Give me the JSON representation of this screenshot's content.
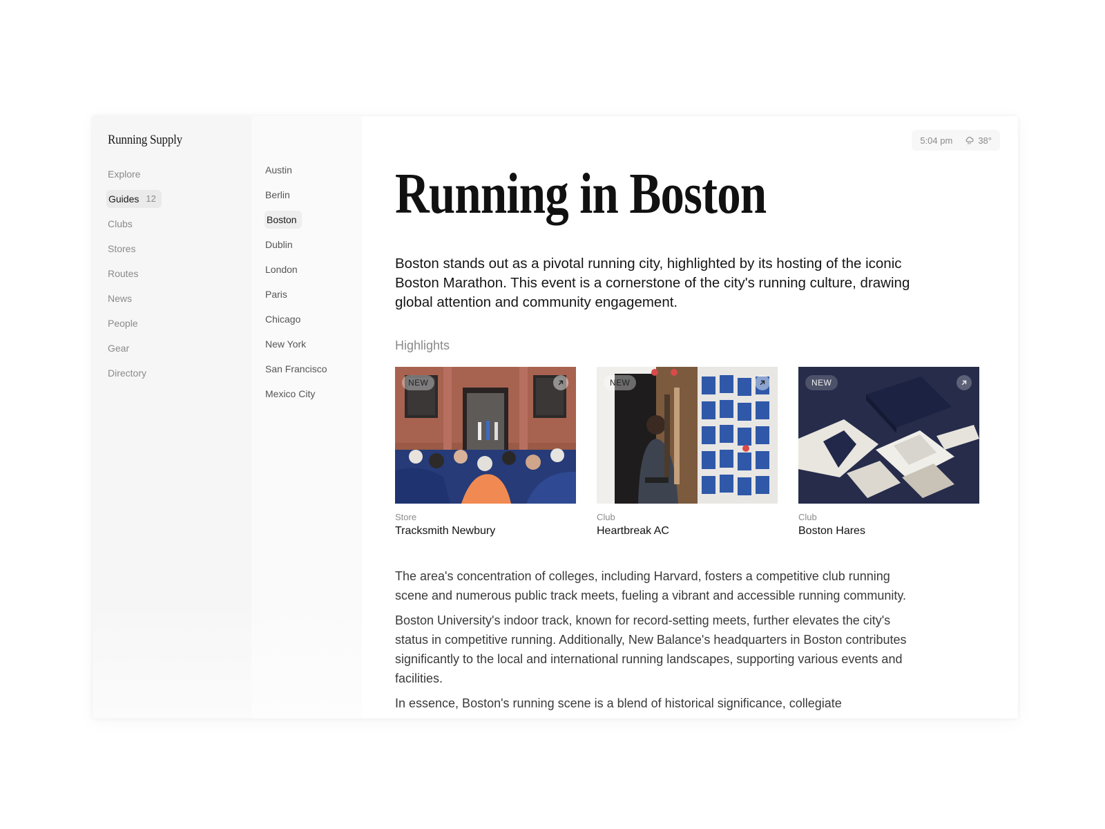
{
  "brand": "Running Supply",
  "nav": {
    "items": [
      {
        "label": "Explore"
      },
      {
        "label": "Guides",
        "count": "12",
        "active": true
      },
      {
        "label": "Clubs"
      },
      {
        "label": "Stores"
      },
      {
        "label": "Routes"
      },
      {
        "label": "News"
      },
      {
        "label": "People"
      },
      {
        "label": "Gear"
      },
      {
        "label": "Directory"
      }
    ]
  },
  "cities": {
    "items": [
      {
        "label": "Austin"
      },
      {
        "label": "Berlin"
      },
      {
        "label": "Boston",
        "active": true
      },
      {
        "label": "Dublin"
      },
      {
        "label": "London"
      },
      {
        "label": "Paris"
      },
      {
        "label": "Chicago"
      },
      {
        "label": "New York"
      },
      {
        "label": "San Francisco"
      },
      {
        "label": "Mexico City"
      }
    ]
  },
  "status": {
    "time": "5:04 pm",
    "temperature": "38°",
    "weather_icon": "cloud-rain-icon"
  },
  "page": {
    "title": "Running in Boston",
    "lede": "Boston stands out as a pivotal running city, highlighted by its hosting of the iconic Boston Marathon. This event is a cornerstone of the city's running culture, drawing global attention and community engagement.",
    "highlights_label": "Highlights",
    "highlights": [
      {
        "badge": "NEW",
        "kind": "Store",
        "name": "Tracksmith Newbury"
      },
      {
        "badge": "NEW",
        "kind": "Club",
        "name": "Heartbreak AC"
      },
      {
        "badge": "NEW",
        "kind": "Club",
        "name": "Boston Hares"
      }
    ],
    "paragraphs": [
      "The area's concentration of colleges, including Harvard, fosters a competitive club running scene and numerous public track meets, fueling a vibrant and accessible running community.",
      "Boston University's indoor track, known for record-setting meets, further elevates the city's status in competitive running. Additionally, New Balance's headquarters in Boston contributes significantly to the local and international running landscapes, supporting various events and facilities.",
      "In essence, Boston's running scene is a blend of historical significance, collegiate"
    ]
  }
}
